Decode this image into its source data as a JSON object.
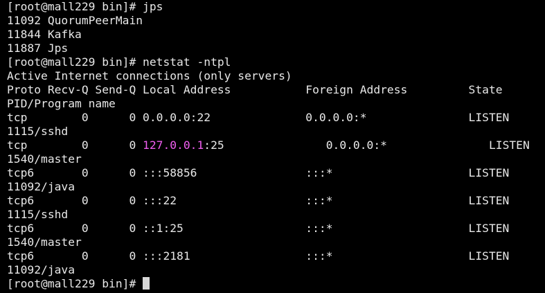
{
  "terminal": {
    "lines": [
      {
        "segments": [
          {
            "text": "[root@mall229 bin]# jps"
          }
        ]
      },
      {
        "segments": [
          {
            "text": "11092 QuorumPeerMain"
          }
        ]
      },
      {
        "segments": [
          {
            "text": "11844 Kafka"
          }
        ]
      },
      {
        "segments": [
          {
            "text": "11887 Jps"
          }
        ]
      },
      {
        "segments": [
          {
            "text": "[root@mall229 bin]# netstat -ntpl"
          }
        ]
      },
      {
        "segments": [
          {
            "text": "Active Internet connections (only servers)"
          }
        ]
      },
      {
        "segments": [
          {
            "text": "Proto Recv-Q Send-Q Local Address           Foreign Address         State"
          }
        ]
      },
      {
        "segments": [
          {
            "text": "PID/Program name"
          }
        ]
      },
      {
        "segments": [
          {
            "text": "tcp        0      0 0.0.0.0:22              0.0.0.0:*               LISTEN"
          }
        ]
      },
      {
        "segments": [
          {
            "text": "1115/sshd"
          }
        ]
      },
      {
        "segments": [
          {
            "text": "tcp        0      0 "
          },
          {
            "text": "127.0.0.1",
            "highlight": true
          },
          {
            "text": ":25               0.0.0.0:*               LISTEN"
          }
        ]
      },
      {
        "segments": [
          {
            "text": "1540/master"
          }
        ]
      },
      {
        "segments": [
          {
            "text": "tcp6       0      0 :::58856                :::*                    LISTEN"
          }
        ]
      },
      {
        "segments": [
          {
            "text": "11092/java"
          }
        ]
      },
      {
        "segments": [
          {
            "text": "tcp6       0      0 :::22                   :::*                    LISTEN"
          }
        ]
      },
      {
        "segments": [
          {
            "text": "1115/sshd"
          }
        ]
      },
      {
        "segments": [
          {
            "text": "tcp6       0      0 ::1:25                  :::*                    LISTEN"
          }
        ]
      },
      {
        "segments": [
          {
            "text": "1540/master"
          }
        ]
      },
      {
        "segments": [
          {
            "text": "tcp6       0      0 :::2181                 :::*                    LISTEN"
          }
        ]
      },
      {
        "segments": [
          {
            "text": "11092/java"
          }
        ]
      }
    ],
    "prompt": "[root@mall229 bin]# ",
    "colors": {
      "background": "#000000",
      "text": "#e8e8e8",
      "highlight": "#f05ef0",
      "cursor": "#d8d8d8"
    }
  }
}
